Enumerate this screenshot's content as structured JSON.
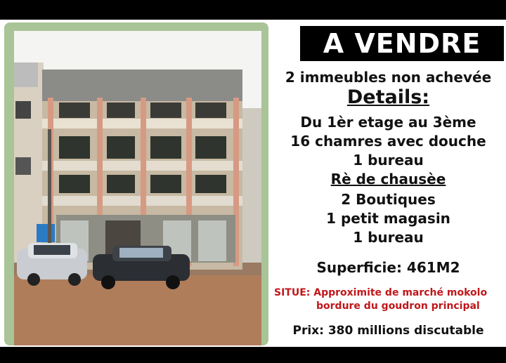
{
  "ad": {
    "title": "A VENDRE",
    "subtitle": "2 immeubles  non achevée",
    "details_heading": "Details:",
    "floors": "Du 1èr etage au 3ème",
    "rooms": "16 chamres avec douche",
    "office_upper": "1 bureau",
    "ground_heading": "Rè de chausèe",
    "shops": "2 Boutiques",
    "store": "1 petit magasin",
    "office_ground": "1 bureau",
    "area": "Superficie: 461M2",
    "location_label": "SITUE:",
    "location_line1": "Approximite de marché mokolo",
    "location_line2": "bordure du goudron principal",
    "price": "Prix: 380 millions discutable"
  },
  "colors": {
    "frame": "#a9c496",
    "title_bg": "#000000",
    "title_text": "#ffffff",
    "location_text": "#c0171b"
  }
}
